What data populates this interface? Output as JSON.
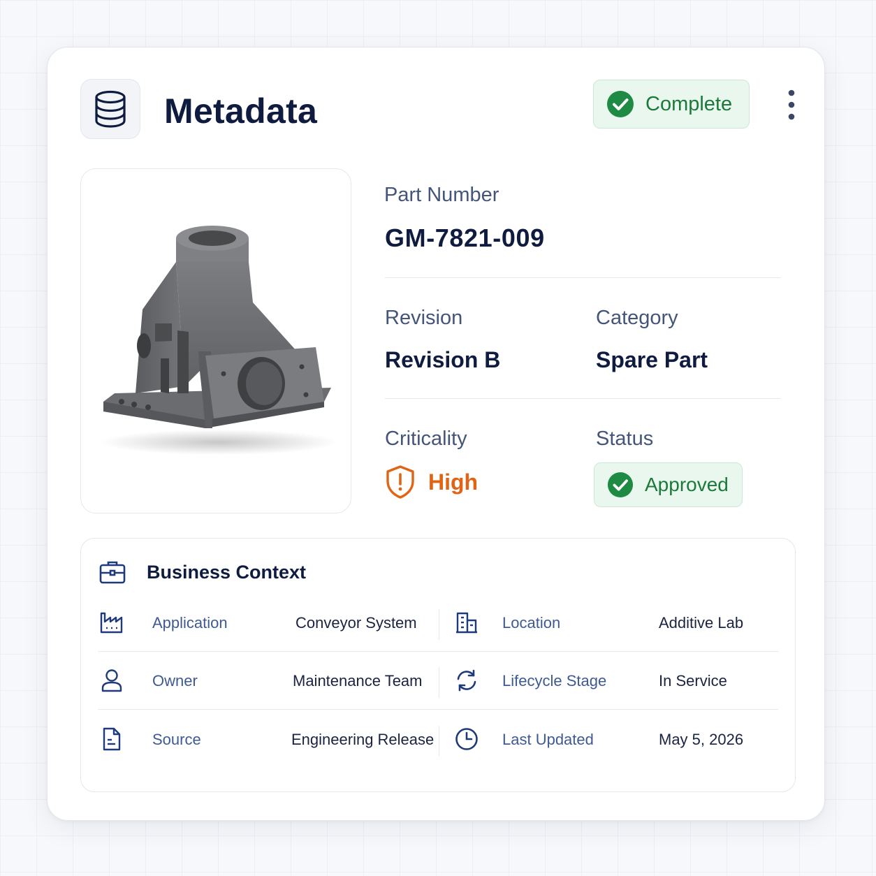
{
  "header": {
    "title": "Metadata",
    "icon": "database-icon",
    "status_badge": "Complete",
    "menu_icon": "more-vertical-icon"
  },
  "part_image": {
    "alt": "gray 3D printed bracket part"
  },
  "fields": {
    "part_number": {
      "label": "Part Number",
      "value": "GM-7821-009"
    },
    "revision": {
      "label": "Revision",
      "value": "Revision B"
    },
    "category": {
      "label": "Category",
      "value": "Spare Part"
    },
    "criticality": {
      "label": "Criticality",
      "value": "High"
    },
    "status": {
      "label": "Status",
      "value": "Approved"
    }
  },
  "business_context": {
    "title": "Business Context",
    "rows": [
      [
        {
          "icon": "factory-icon",
          "label": "Application",
          "value": "Conveyor System"
        },
        {
          "icon": "building-icon",
          "label": "Location",
          "value": "Additive Lab"
        }
      ],
      [
        {
          "icon": "user-icon",
          "label": "Owner",
          "value": "Maintenance Team"
        },
        {
          "icon": "refresh-icon",
          "label": "Lifecycle Stage",
          "value": "In Service"
        }
      ],
      [
        {
          "icon": "document-icon",
          "label": "Source",
          "value": "Engineering Release"
        },
        {
          "icon": "clock-icon",
          "label": "Last Updated",
          "value": "May 5, 2026"
        }
      ]
    ]
  },
  "colors": {
    "primary_text": "#0f1c3f",
    "success": "#1b7a3a",
    "success_bg": "#eaf7ee",
    "warning": "#e06413",
    "label_text": "#45557a"
  }
}
